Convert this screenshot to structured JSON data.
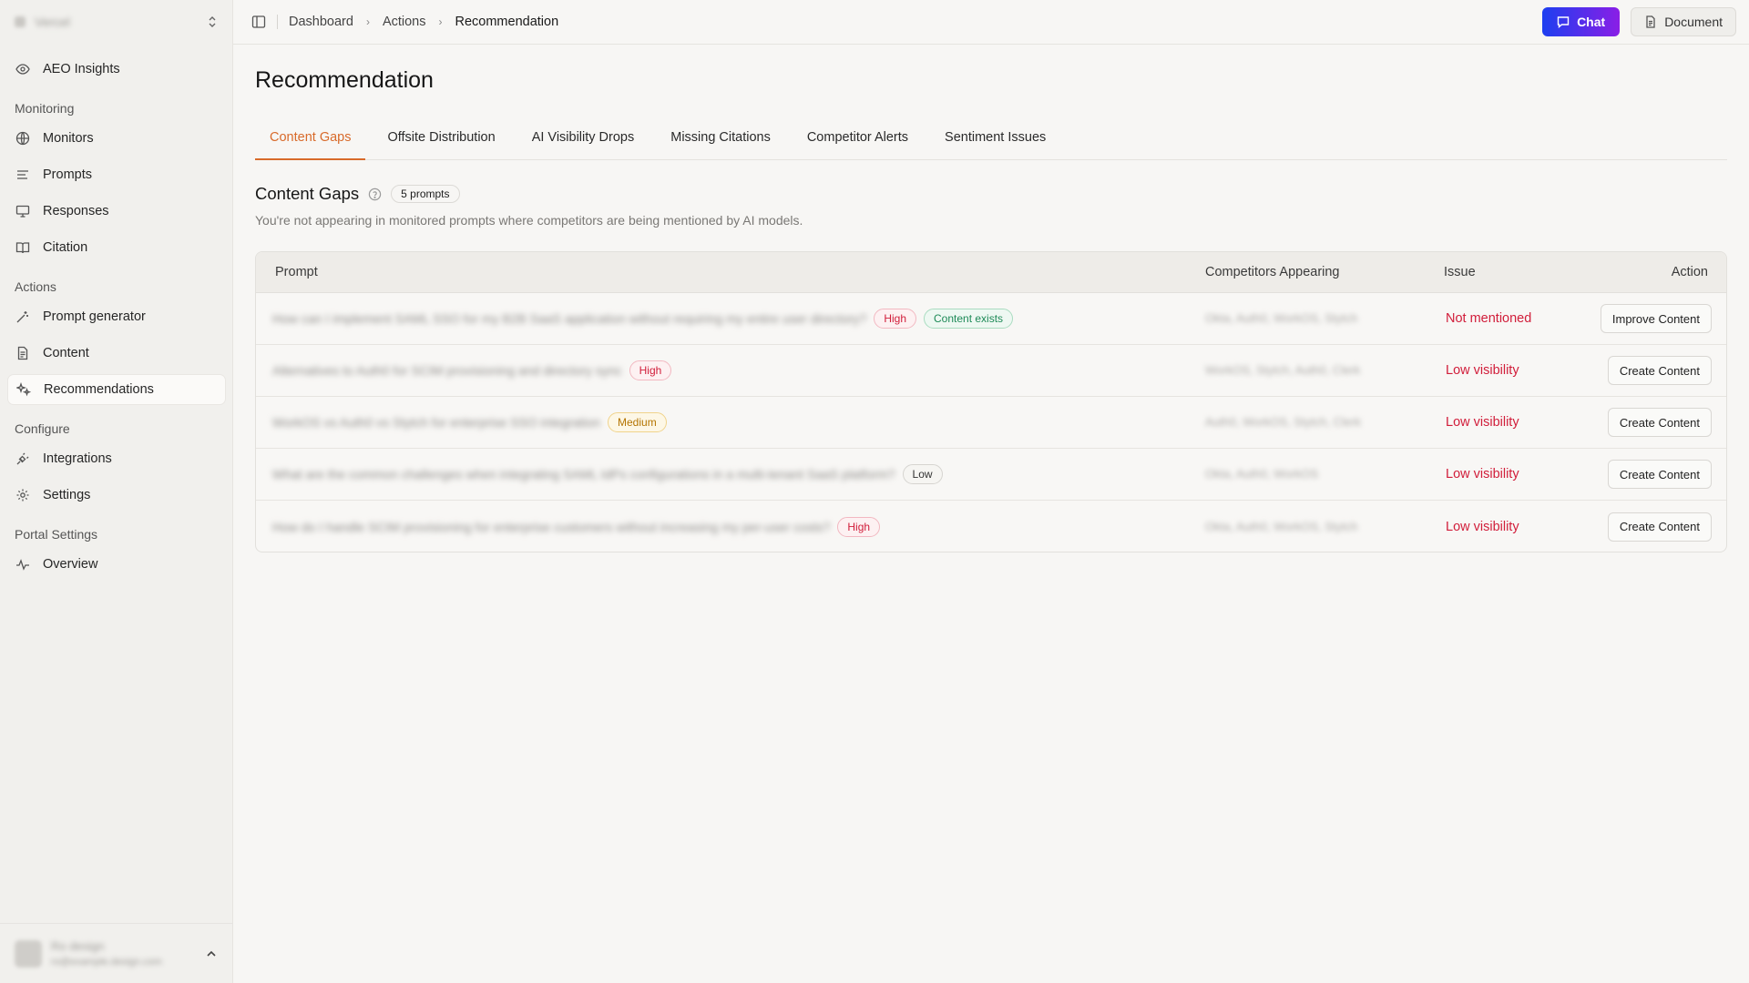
{
  "sidebar": {
    "workspace_name": "Vercel",
    "top_items": [
      {
        "label": "AEO Insights",
        "icon": "eye-icon"
      }
    ],
    "sections": [
      {
        "title": "Monitoring",
        "items": [
          {
            "label": "Monitors",
            "icon": "globe-icon"
          },
          {
            "label": "Prompts",
            "icon": "list-icon"
          },
          {
            "label": "Responses",
            "icon": "monitor-icon"
          },
          {
            "label": "Citation",
            "icon": "book-icon"
          }
        ]
      },
      {
        "title": "Actions",
        "items": [
          {
            "label": "Prompt generator",
            "icon": "wand-icon"
          },
          {
            "label": "Content",
            "icon": "document-icon"
          },
          {
            "label": "Recommendations",
            "icon": "sparkles-icon",
            "active": true
          }
        ]
      },
      {
        "title": "Configure",
        "items": [
          {
            "label": "Integrations",
            "icon": "plug-icon"
          },
          {
            "label": "Settings",
            "icon": "gear-icon"
          }
        ]
      },
      {
        "title": "Portal Settings",
        "items": [
          {
            "label": "Overview",
            "icon": "activity-icon"
          }
        ]
      }
    ],
    "user": {
      "name": "Ro design",
      "email": "ro@example.design.com"
    }
  },
  "topbar": {
    "breadcrumb": [
      "Dashboard",
      "Actions",
      "Recommendation"
    ],
    "chat_label": "Chat",
    "document_label": "Document"
  },
  "page": {
    "title": "Recommendation",
    "tabs": [
      "Content Gaps",
      "Offsite Distribution",
      "AI Visibility Drops",
      "Missing Citations",
      "Competitor Alerts",
      "Sentiment Issues"
    ],
    "active_tab": "Content Gaps",
    "section_title": "Content Gaps",
    "count_badge": "5 prompts",
    "section_subtitle": "You're not appearing in monitored prompts where competitors are being mentioned by AI models."
  },
  "table": {
    "headers": {
      "prompt": "Prompt",
      "competitors": "Competitors Appearing",
      "issue": "Issue",
      "action": "Action"
    },
    "rows": [
      {
        "prompt": "How can I implement SAML SSO for my B2B SaaS application without requiring my entire user directory?",
        "tags": [
          {
            "label": "High",
            "kind": "high"
          },
          {
            "label": "Content exists",
            "kind": "exists"
          }
        ],
        "competitors": "Okta, Auth0, WorkOS, Stytch",
        "issue": "Not mentioned",
        "action": "Improve Content"
      },
      {
        "prompt": "Alternatives to Auth0 for SCIM provisioning and directory sync",
        "tags": [
          {
            "label": "High",
            "kind": "high"
          }
        ],
        "competitors": "WorkOS, Stytch, Auth0, Clerk",
        "issue": "Low visibility",
        "action": "Create Content"
      },
      {
        "prompt": "WorkOS vs Auth0 vs Stytch for enterprise SSO integration",
        "tags": [
          {
            "label": "Medium",
            "kind": "medium"
          }
        ],
        "competitors": "Auth0, WorkOS, Stytch, Clerk",
        "issue": "Low visibility",
        "action": "Create Content"
      },
      {
        "prompt": "What are the common challenges when integrating SAML IdPs configurations in a multi-tenant SaaS platform?",
        "tags": [
          {
            "label": "Low",
            "kind": "low"
          }
        ],
        "competitors": "Okta, Auth0, WorkOS",
        "issue": "Low visibility",
        "action": "Create Content"
      },
      {
        "prompt": "How do I handle SCIM provisioning for enterprise customers without increasing my per-user costs?",
        "tags": [
          {
            "label": "High",
            "kind": "high"
          }
        ],
        "competitors": "Okta, Auth0, WorkOS, Stytch",
        "issue": "Low visibility",
        "action": "Create Content"
      }
    ]
  }
}
